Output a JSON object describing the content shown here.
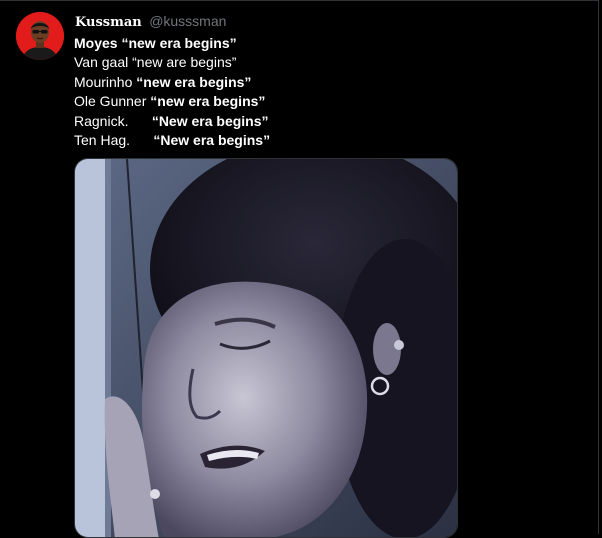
{
  "tweet": {
    "author": {
      "display_name": "Kussman",
      "handle": "@kusssman",
      "avatar_icon": "profile-avatar-icon",
      "avatar_color": "#e21b1b"
    },
    "lines": [
      {
        "label": "Moyes",
        "quote": "“new era begins”"
      },
      {
        "label": "Van gaal",
        "quote": "“new are begins”"
      },
      {
        "label": "Mourinho",
        "quote": "“new era begins”"
      },
      {
        "label": "Ole Gunner",
        "quote": "“new era begins”"
      },
      {
        "label": "Ragnick.     ",
        "quote": "“New era begins”"
      },
      {
        "label": "Ten Hag.     ",
        "quote": "“New era begins”"
      }
    ],
    "media": {
      "icon": "crying-woman-photo"
    }
  },
  "colors": {
    "background": "#000000",
    "text": "#ffffff",
    "secondary_text": "#71767b",
    "border": "#2f3336"
  }
}
